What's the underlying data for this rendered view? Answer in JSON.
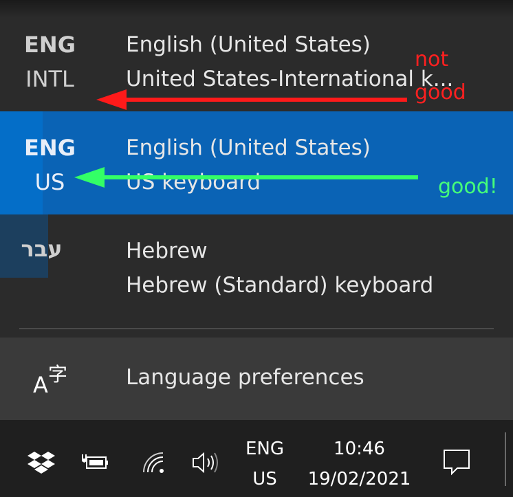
{
  "languages": [
    {
      "abbr_line1": "ENG",
      "abbr_line2": "INTL",
      "name": "English (United States)",
      "keyboard": "United States-International k...",
      "selected": false
    },
    {
      "abbr_line1": "ENG",
      "abbr_line2": "US",
      "name": "English (United States)",
      "keyboard": "US keyboard",
      "selected": true
    },
    {
      "abbr_line1": "עבר",
      "abbr_line2": "",
      "name": "Hebrew",
      "keyboard": "Hebrew (Standard) keyboard",
      "selected": false
    }
  ],
  "preferences": {
    "label": "Language preferences",
    "icon_glyph_a": "A",
    "icon_glyph_zi": "字"
  },
  "taskbar": {
    "lang_line1": "ENG",
    "lang_line2": "US",
    "time": "10:46",
    "date": "19/02/2021"
  },
  "annotations": {
    "not_good_line1": "not",
    "not_good_line2": "good",
    "good": "good!",
    "red": "#ff1a1a",
    "green": "#33ff66"
  },
  "colors": {
    "selected_bg": "#0a63b5",
    "flyout_bg": "#2b2b2b",
    "taskbar_bg": "#1f1f1f"
  }
}
